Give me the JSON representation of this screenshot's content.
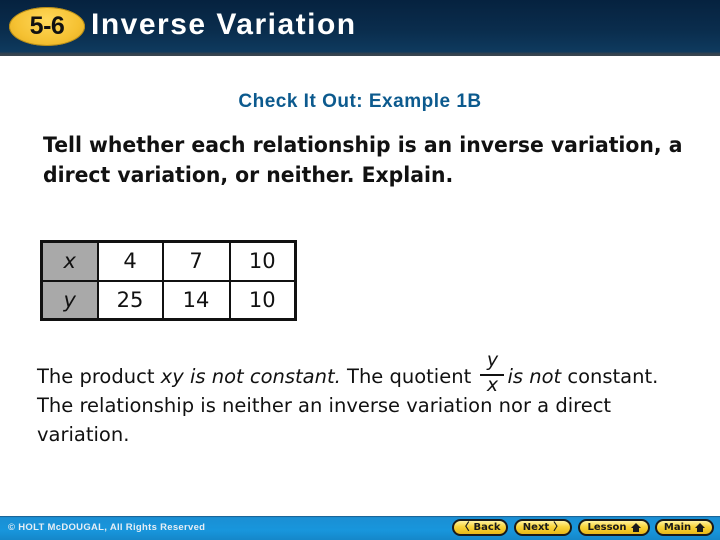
{
  "header": {
    "lesson_number": "5-6",
    "title": "Inverse Variation"
  },
  "subtitle": "Check It Out: Example 1B",
  "prompt": "Tell whether each relationship is an inverse variation, a direct variation, or neither. Explain.",
  "table": {
    "rows": [
      {
        "label": "x",
        "values": [
          "4",
          "7",
          "10"
        ]
      },
      {
        "label": "y",
        "values": [
          "25",
          "14",
          "10"
        ]
      }
    ]
  },
  "explanation": {
    "part1": "The product ",
    "part2_italic": "xy is not constant.",
    "part3": " The quotient ",
    "fraction": {
      "numerator": "y",
      "denominator": "x"
    },
    "part4_italic": "is not",
    "part5": " constant. The relationship is neither an inverse variation nor a direct variation."
  },
  "footer": {
    "copyright": "© HOLT McDOUGAL, All Rights Reserved",
    "buttons": {
      "back": {
        "label": "Back",
        "icon": "chevron-left-icon",
        "glyph": "〈"
      },
      "next": {
        "label": "Next",
        "icon": "chevron-right-icon",
        "glyph": "〉"
      },
      "lesson": {
        "label": "Lesson",
        "icon": "home-icon"
      },
      "main": {
        "label": "Main",
        "icon": "home-icon"
      }
    }
  },
  "colors": {
    "header_bg": "#0a2d4d",
    "badge": "#f5c132",
    "subtitle": "#0c5a8e",
    "table_header_bg": "#a9a9a9",
    "footer_bg": "#1896dc",
    "nav_button": "#f8d43a"
  }
}
